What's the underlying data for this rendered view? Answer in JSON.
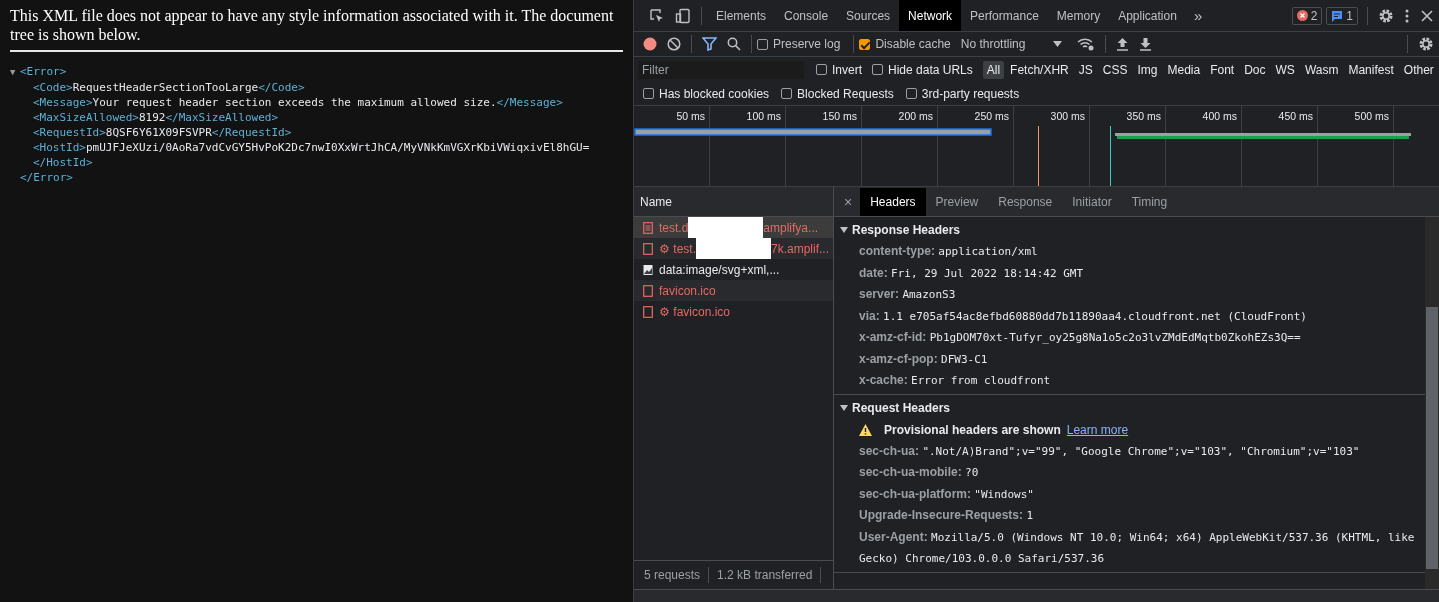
{
  "xml_viewer": {
    "notice": "This XML file does not appear to have any style information associated with it. The document tree is shown below.",
    "tree": {
      "expanded": true,
      "toggle": "▼",
      "open_tag": "<Error>",
      "close_tag": "</Error>",
      "children": [
        {
          "open": "<Code>",
          "value": "RequestHeaderSectionTooLarge",
          "close": "</Code>",
          "close_on_new_line": false
        },
        {
          "open": "<Message>",
          "value": "Your request header section exceeds the maximum allowed size.",
          "close": "</Message>",
          "close_on_new_line": false
        },
        {
          "open": "<MaxSizeAllowed>",
          "value": "8192",
          "close": "</MaxSizeAllowed>",
          "close_on_new_line": false
        },
        {
          "open": "<RequestId>",
          "value": "8QSF6Y61X09FSVPR",
          "close": "</RequestId>",
          "close_on_new_line": false
        },
        {
          "open": "<HostId>",
          "value": "pmUJFJeXUzi/0AoRa7vdCvGY5HvPoK2Dc7nwI0XxWrtJhCA/MyVNkKmVGXrKbiVWiqxivEl8hGU=",
          "close": "</HostId>",
          "close_on_new_line": true
        }
      ]
    }
  },
  "devtools": {
    "tabs": [
      {
        "label": "Elements",
        "selected": false
      },
      {
        "label": "Console",
        "selected": false
      },
      {
        "label": "Sources",
        "selected": false
      },
      {
        "label": "Network",
        "selected": true
      },
      {
        "label": "Performance",
        "selected": false
      },
      {
        "label": "Memory",
        "selected": false
      },
      {
        "label": "Application",
        "selected": false
      }
    ],
    "more": "»",
    "badges": [
      {
        "kind": "error",
        "count": "2"
      },
      {
        "kind": "message",
        "count": "1"
      }
    ],
    "toolbar": {
      "recording": true,
      "preserve_log": {
        "label": "Preserve log",
        "checked": false
      },
      "disable_cache": {
        "label": "Disable cache",
        "checked": true
      },
      "throttling": "No throttling"
    },
    "filter": {
      "placeholder": "Filter",
      "invert": {
        "label": "Invert",
        "checked": false
      },
      "hide_data_urls": {
        "label": "Hide data URLs",
        "checked": false
      },
      "types": [
        {
          "label": "All",
          "selected": true
        },
        {
          "label": "Fetch/XHR",
          "selected": false
        },
        {
          "label": "JS",
          "selected": false
        },
        {
          "label": "CSS",
          "selected": false
        },
        {
          "label": "Img",
          "selected": false
        },
        {
          "label": "Media",
          "selected": false
        },
        {
          "label": "Font",
          "selected": false
        },
        {
          "label": "Doc",
          "selected": false
        },
        {
          "label": "WS",
          "selected": false
        },
        {
          "label": "Wasm",
          "selected": false
        },
        {
          "label": "Manifest",
          "selected": false
        },
        {
          "label": "Other",
          "selected": false
        }
      ]
    },
    "options": [
      {
        "label": "Has blocked cookies",
        "checked": false
      },
      {
        "label": "Blocked Requests",
        "checked": false
      },
      {
        "label": "3rd-party requests",
        "checked": false
      }
    ],
    "timeline": {
      "ticks": [
        "50 ms",
        "100 ms",
        "150 ms",
        "200 ms",
        "250 ms",
        "300 ms",
        "350 ms",
        "400 ms",
        "450 ms",
        "500 ms"
      ]
    },
    "requests": {
      "column": "Name",
      "items": [
        {
          "kind": "document",
          "name_start": "test.d",
          "name_end": "amplifya...",
          "redacted": true,
          "failed": true,
          "selected": true
        },
        {
          "kind": "blank",
          "name_start": "⚙ test.",
          "name_end": "7k.amplif...",
          "redacted": true,
          "failed": true,
          "selected": false
        },
        {
          "kind": "image",
          "name_start": "data:image/svg+xml,...",
          "redacted": false,
          "failed": false,
          "selected": false
        },
        {
          "kind": "blank",
          "name_start": "favicon.ico",
          "redacted": false,
          "failed": true,
          "selected": false
        },
        {
          "kind": "blank",
          "name_start": "⚙ favicon.ico",
          "redacted": false,
          "failed": true,
          "selected": false
        }
      ]
    },
    "status": {
      "requests": "5 requests",
      "transferred": "1.2 kB transferred"
    },
    "detail": {
      "close": "×",
      "tabs": [
        {
          "label": "Headers",
          "selected": true
        },
        {
          "label": "Preview",
          "selected": false
        },
        {
          "label": "Response",
          "selected": false
        },
        {
          "label": "Initiator",
          "selected": false
        },
        {
          "label": "Timing",
          "selected": false
        }
      ],
      "sections": [
        {
          "title": "Response Headers",
          "expanded": true,
          "headers": [
            {
              "name": "content-type:",
              "value": "application/xml"
            },
            {
              "name": "date:",
              "value": "Fri, 29 Jul 2022 18:14:42 GMT"
            },
            {
              "name": "server:",
              "value": "AmazonS3"
            },
            {
              "name": "via:",
              "value": "1.1 e705af54ac8efbd60880dd7b11890aa4.cloudfront.net (CloudFront)"
            },
            {
              "name": "x-amz-cf-id:",
              "value": "Pb1gDOM70xt-Tufyr_oy25g8Na1o5c2o3lvZMdEdMqtb0ZkohEZs3Q=="
            },
            {
              "name": "x-amz-cf-pop:",
              "value": "DFW3-C1"
            },
            {
              "name": "x-cache:",
              "value": "Error from cloudfront"
            }
          ]
        },
        {
          "title": "Request Headers",
          "expanded": true,
          "warning": {
            "text": "Provisional headers are shown",
            "link": "Learn more"
          },
          "headers": [
            {
              "name": "sec-ch-ua:",
              "value": "\".Not/A)Brand\";v=\"99\", \"Google Chrome\";v=\"103\", \"Chromium\";v=\"103\""
            },
            {
              "name": "sec-ch-ua-mobile:",
              "value": "?0"
            },
            {
              "name": "sec-ch-ua-platform:",
              "value": "\"Windows\""
            },
            {
              "name": "Upgrade-Insecure-Requests:",
              "value": "1"
            },
            {
              "name": "User-Agent:",
              "value": "Mozilla/5.0 (Windows NT 10.0; Win64; x64) AppleWebKit/537.36 (KHTML, like Gecko) Chrome/103.0.0.0 Safari/537.36"
            }
          ]
        }
      ]
    }
  }
}
